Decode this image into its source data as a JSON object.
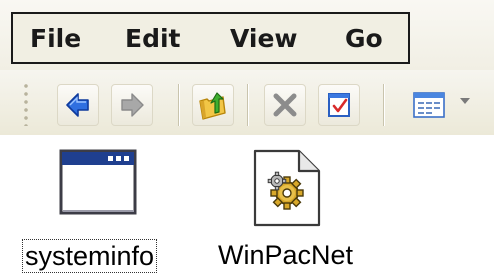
{
  "menu": {
    "file": "File",
    "edit": "Edit",
    "view": "View",
    "go": "Go"
  },
  "toolbar": {
    "buttons": [
      {
        "icon": "back-arrow-icon",
        "color": "#1a5bd6"
      },
      {
        "icon": "forward-arrow-icon",
        "color": "#9a9a9a"
      },
      {
        "icon": "folder-up-icon",
        "color": "#3a9a2a"
      },
      {
        "icon": "delete-x-icon",
        "color": "#8a8a8a"
      },
      {
        "icon": "properties-icon",
        "color": "#d83a3a"
      },
      {
        "icon": "views-icon",
        "color": "#3a7ad8"
      }
    ]
  },
  "files": [
    {
      "name": "systeminfo",
      "icon": "window-app-icon",
      "selected": true
    },
    {
      "name": "WinPacNet",
      "icon": "gear-document-icon",
      "selected": false
    }
  ]
}
